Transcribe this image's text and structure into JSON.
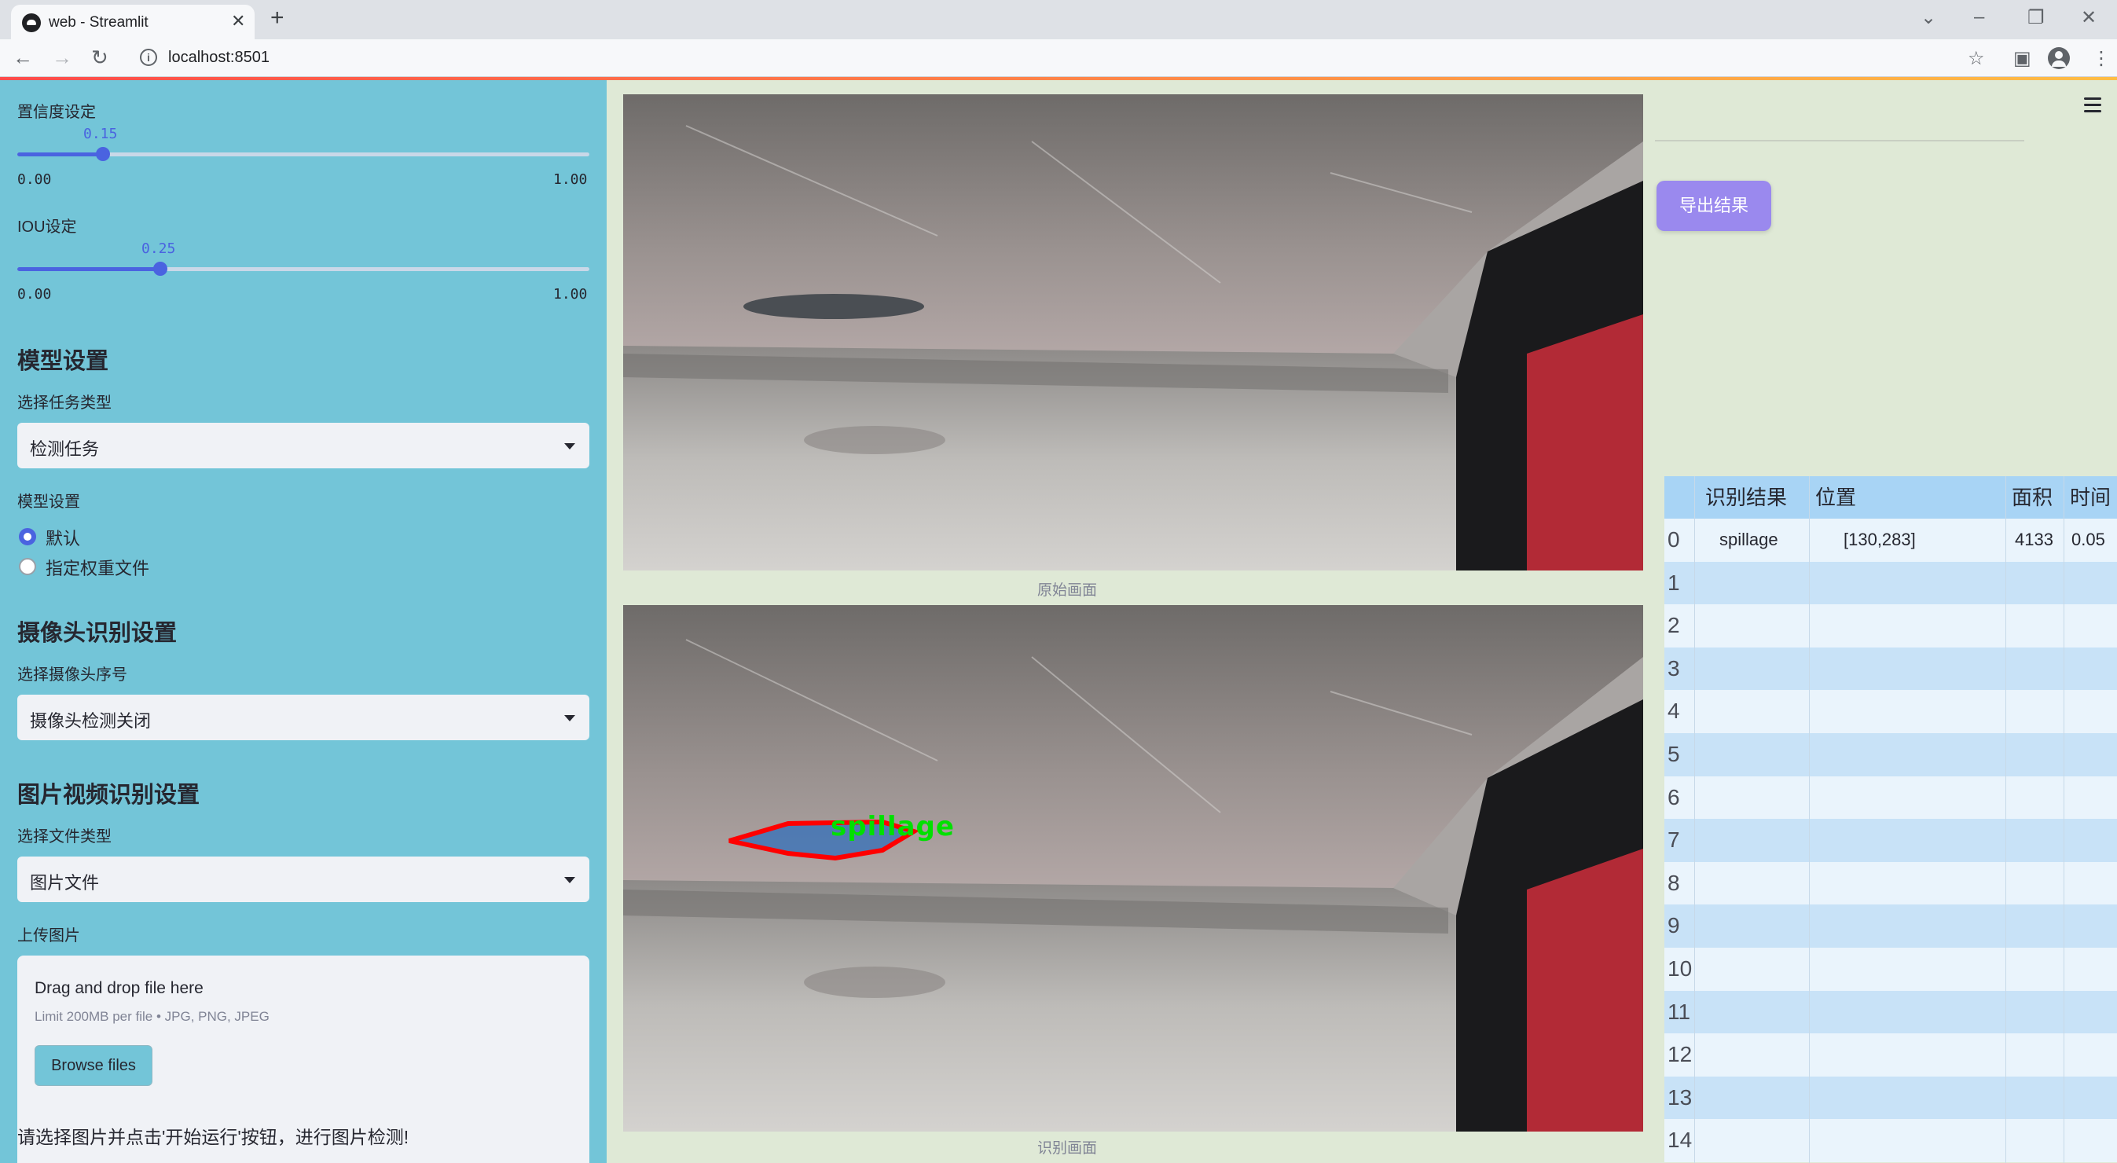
{
  "browser": {
    "tab_title": "web - Streamlit",
    "url": "localhost:8501"
  },
  "sidebar": {
    "confidence": {
      "label": "置信度设定",
      "value": "0.15",
      "min": "0.00",
      "max": "1.00",
      "fraction": 0.15
    },
    "iou": {
      "label": "IOU设定",
      "value": "0.25",
      "min": "0.00",
      "max": "1.00",
      "fraction": 0.25
    },
    "model_section": {
      "title": "模型设置",
      "task_label": "选择任务类型",
      "task_value": "检测任务",
      "model_label": "模型设置",
      "options": [
        "默认",
        "指定权重文件"
      ],
      "selected_index": 0
    },
    "camera_section": {
      "title": "摄像头识别设置",
      "camera_label": "选择摄像头序号",
      "camera_value": "摄像头检测关闭"
    },
    "media_section": {
      "title": "图片视频识别设置",
      "filetype_label": "选择文件类型",
      "filetype_value": "图片文件",
      "upload_label": "上传图片",
      "drop_text": "Drag and drop file here",
      "limit_text": "Limit 200MB per file • JPG, PNG, JPEG",
      "browse_label": "Browse files"
    },
    "hint": "请选择图片并点击'开始运行'按钮，进行图片检测!"
  },
  "main": {
    "original_caption": "原始画面",
    "result_caption": "识别画面",
    "detection_label": "spillage"
  },
  "results": {
    "export_label": "导出结果",
    "columns": [
      "",
      "识别结果",
      "位置",
      "面积",
      "时间"
    ],
    "rows": [
      [
        "0",
        "spillage",
        "[130,283]",
        "4133",
        "0.05"
      ],
      [
        "1",
        "",
        "",
        "",
        ""
      ],
      [
        "2",
        "",
        "",
        "",
        ""
      ],
      [
        "3",
        "",
        "",
        "",
        ""
      ],
      [
        "4",
        "",
        "",
        "",
        ""
      ],
      [
        "5",
        "",
        "",
        "",
        ""
      ],
      [
        "6",
        "",
        "",
        "",
        ""
      ],
      [
        "7",
        "",
        "",
        "",
        ""
      ],
      [
        "8",
        "",
        "",
        "",
        ""
      ],
      [
        "9",
        "",
        "",
        "",
        ""
      ],
      [
        "10",
        "",
        "",
        "",
        ""
      ],
      [
        "11",
        "",
        "",
        "",
        ""
      ],
      [
        "12",
        "",
        "",
        "",
        ""
      ],
      [
        "13",
        "",
        "",
        "",
        ""
      ],
      [
        "14",
        "",
        "",
        "",
        ""
      ]
    ]
  },
  "colors": {
    "sidebar_bg": "#73c5d8",
    "main_bg": "#dfe9d6",
    "accent": "#4a63e0",
    "export_button": "#9a89ee",
    "detection_box": "#ff0000",
    "detection_text": "#00e000"
  }
}
